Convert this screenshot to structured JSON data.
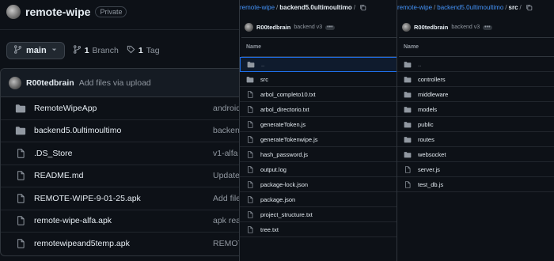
{
  "repo": {
    "name": "remote-wipe",
    "visibility": "Private",
    "branch": "main",
    "branches_count": "1",
    "branches_label": "Branch",
    "tags_count": "1",
    "tags_label": "Tag",
    "commit_author": "R00tedbrain",
    "commit_message": "Add files via upload",
    "files": [
      {
        "name": "RemoteWipeApp",
        "type": "folder",
        "commit": "android"
      },
      {
        "name": "backend5.0ultimoultimo",
        "type": "folder",
        "commit": "backen"
      },
      {
        "name": ".DS_Store",
        "type": "file",
        "commit": "v1-alfa"
      },
      {
        "name": "README.md",
        "type": "file",
        "commit": "Update"
      },
      {
        "name": "REMOTE-WIPE-9-01-25.apk",
        "type": "file",
        "commit": "Add file"
      },
      {
        "name": "remote-wipe-alfa.apk",
        "type": "file",
        "commit": "apk rea"
      },
      {
        "name": "remotewipeand5temp.apk",
        "type": "file",
        "commit": "REMOT"
      }
    ]
  },
  "panel2": {
    "crumb_root": "remote-wipe",
    "crumb_sep": "/",
    "crumb_current": "backend5.0ultimoultimo",
    "crumb_trail": "/",
    "author": "R00tedbrain",
    "message": "backend v3",
    "more": "•••",
    "column_name": "Name",
    "items": [
      {
        "name": "..",
        "type": "folder",
        "selected": true,
        "parent": true
      },
      {
        "name": "src",
        "type": "folder"
      },
      {
        "name": "arbol_completo10.txt",
        "type": "file"
      },
      {
        "name": "arbol_directorio.txt",
        "type": "file"
      },
      {
        "name": "generateToken.js",
        "type": "file"
      },
      {
        "name": "generateTokenwipe.js",
        "type": "file"
      },
      {
        "name": "hash_password.js",
        "type": "file"
      },
      {
        "name": "output.log",
        "type": "file"
      },
      {
        "name": "package-lock.json",
        "type": "file"
      },
      {
        "name": "package.json",
        "type": "file"
      },
      {
        "name": "project_structure.txt",
        "type": "file"
      },
      {
        "name": "tree.txt",
        "type": "file"
      }
    ]
  },
  "panel3": {
    "crumb_root": "remote-wipe",
    "crumb_sep1": "/",
    "crumb_mid": "backend5.0ultimoultimo",
    "crumb_sep2": "/",
    "crumb_current": "src",
    "crumb_trail": "/",
    "author": "R00tedbrain",
    "message": "backend v3",
    "more": "•••",
    "column_name": "Name",
    "items": [
      {
        "name": "..",
        "type": "folder",
        "parent": true
      },
      {
        "name": "controllers",
        "type": "folder"
      },
      {
        "name": "middleware",
        "type": "folder"
      },
      {
        "name": "models",
        "type": "folder"
      },
      {
        "name": "public",
        "type": "folder"
      },
      {
        "name": "routes",
        "type": "folder"
      },
      {
        "name": "websocket",
        "type": "folder"
      },
      {
        "name": "server.js",
        "type": "file"
      },
      {
        "name": "test_db.js",
        "type": "file"
      }
    ]
  },
  "colors": {
    "background": "#0d1117",
    "link": "#4493f8",
    "folder": "#9198a1",
    "border": "#30363d"
  },
  "icons": {
    "folder": "folder-icon",
    "file": "file-icon",
    "branch": "git-branch-icon",
    "tag": "tag-icon",
    "copy": "copy-icon",
    "caret": "chevron-down-icon"
  }
}
